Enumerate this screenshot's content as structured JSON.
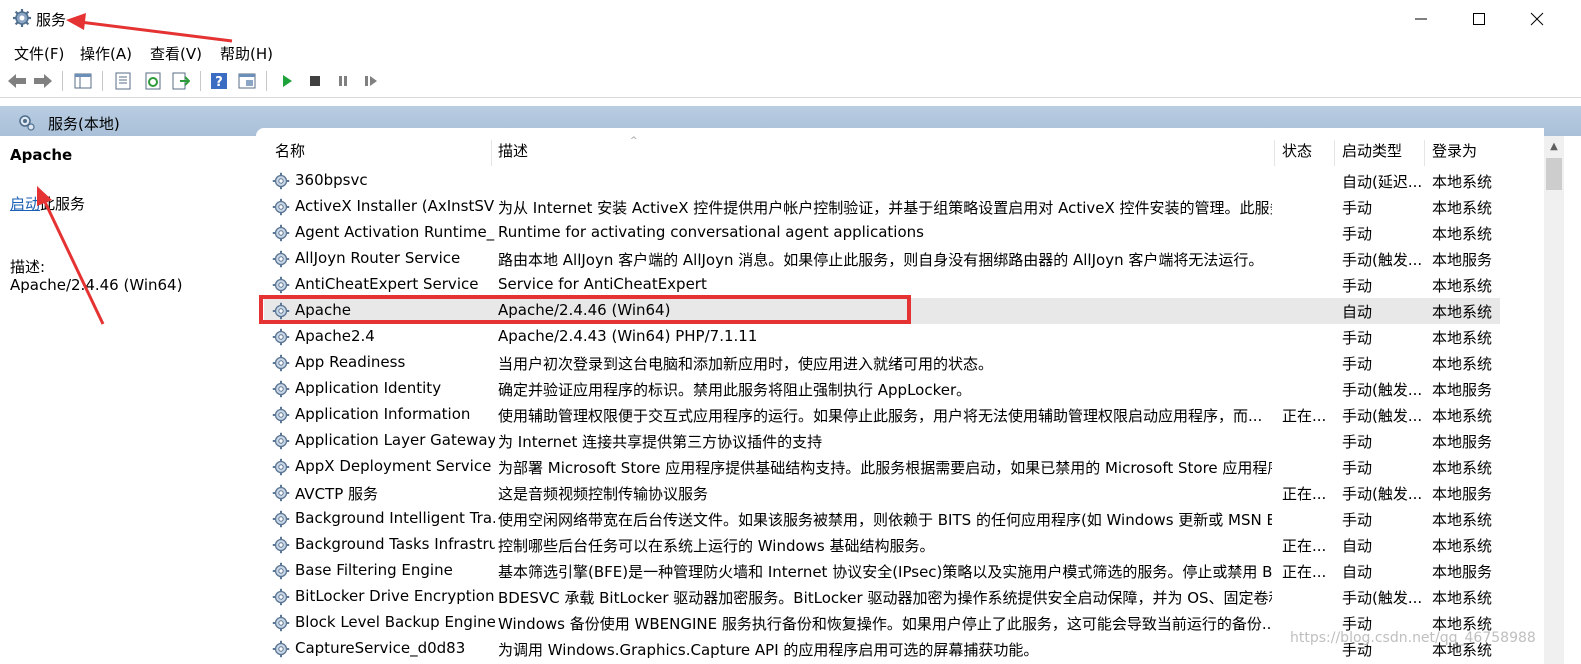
{
  "window": {
    "title": "服务",
    "icon": "gear-icon"
  },
  "menu": [
    "文件(F)",
    "操作(A)",
    "查看(V)",
    "帮助(H)"
  ],
  "toolbar": {
    "buttons": [
      "back-icon",
      "forward-icon",
      "show-tree-icon",
      "properties-icon",
      "refresh-icon",
      "export-icon",
      "help-icon",
      "console-icon",
      "start-service-icon",
      "stop-service-icon",
      "pause-service-icon",
      "restart-service-icon"
    ]
  },
  "scope": {
    "title": "服务(本地)"
  },
  "left_panel": {
    "service_name": "Apache",
    "start_link": "启动",
    "start_suffix": "此服务",
    "desc_label": "描述:",
    "desc_value": "Apache/2.4.46 (Win64)"
  },
  "columns": {
    "name": "名称",
    "desc": "描述",
    "status": "状态",
    "startup": "启动类型",
    "logon": "登录为"
  },
  "rows": [
    {
      "name": "360bpsvc",
      "desc": "",
      "status": "",
      "startup": "自动(延迟...",
      "logon": "本地系统"
    },
    {
      "name": "ActiveX Installer (AxInstSV)",
      "desc": "为从 Internet 安装 ActiveX 控件提供用户帐户控制验证，并基于组策略设置启用对 ActiveX 控件安装的管理。此服务...",
      "status": "",
      "startup": "手动",
      "logon": "本地系统"
    },
    {
      "name": "Agent Activation Runtime_...",
      "desc": "Runtime for activating conversational agent applications",
      "status": "",
      "startup": "手动",
      "logon": "本地系统"
    },
    {
      "name": "AllJoyn Router Service",
      "desc": "路由本地 AllJoyn 客户端的 AllJoyn 消息。如果停止此服务，则自身没有捆绑路由器的 AllJoyn 客户端将无法运行。",
      "status": "",
      "startup": "手动(触发...",
      "logon": "本地服务"
    },
    {
      "name": "AntiCheatExpert Service",
      "desc": "Service for AntiCheatExpert",
      "status": "",
      "startup": "手动",
      "logon": "本地系统"
    },
    {
      "name": "Apache",
      "desc": "Apache/2.4.46 (Win64)",
      "status": "",
      "startup": "自动",
      "logon": "本地系统"
    },
    {
      "name": "Apache2.4",
      "desc": "Apache/2.4.43 (Win64) PHP/7.1.11",
      "status": "",
      "startup": "手动",
      "logon": "本地系统"
    },
    {
      "name": "App Readiness",
      "desc": "当用户初次登录到这台电脑和添加新应用时，使应用进入就绪可用的状态。",
      "status": "",
      "startup": "手动",
      "logon": "本地系统"
    },
    {
      "name": "Application Identity",
      "desc": "确定并验证应用程序的标识。禁用此服务将阻止强制执行 AppLocker。",
      "status": "",
      "startup": "手动(触发...",
      "logon": "本地服务"
    },
    {
      "name": "Application Information",
      "desc": "使用辅助管理权限便于交互式应用程序的运行。如果停止此服务，用户将无法使用辅助管理权限启动应用程序，而...",
      "status": "正在...",
      "startup": "手动(触发...",
      "logon": "本地系统"
    },
    {
      "name": "Application Layer Gateway ...",
      "desc": "为 Internet 连接共享提供第三方协议插件的支持",
      "status": "",
      "startup": "手动",
      "logon": "本地服务"
    },
    {
      "name": "AppX Deployment Service ...",
      "desc": "为部署 Microsoft Store 应用程序提供基础结构支持。此服务根据需要启动，如果已禁用的 Microsoft Store 应用程序...",
      "status": "",
      "startup": "手动",
      "logon": "本地系统"
    },
    {
      "name": "AVCTP 服务",
      "desc": "这是音频视频控制传输协议服务",
      "status": "正在...",
      "startup": "手动(触发...",
      "logon": "本地服务"
    },
    {
      "name": "Background Intelligent Tra...",
      "desc": "使用空闲网络带宽在后台传送文件。如果该服务被禁用，则依赖于 BITS 的任何应用程序(如 Windows 更新或 MSN E...",
      "status": "",
      "startup": "手动",
      "logon": "本地系统"
    },
    {
      "name": "Background Tasks Infrastru...",
      "desc": "控制哪些后台任务可以在系统上运行的 Windows 基础结构服务。",
      "status": "正在...",
      "startup": "自动",
      "logon": "本地系统"
    },
    {
      "name": "Base Filtering Engine",
      "desc": "基本筛选引擎(BFE)是一种管理防火墙和 Internet 协议安全(IPsec)策略以及实施用户模式筛选的服务。停止或禁用 BF...",
      "status": "正在...",
      "startup": "自动",
      "logon": "本地服务"
    },
    {
      "name": "BitLocker Drive Encryption ...",
      "desc": "BDESVC 承载 BitLocker 驱动器加密服务。BitLocker 驱动器加密为操作系统提供安全启动保障，并为 OS、固定卷和...",
      "status": "",
      "startup": "手动(触发...",
      "logon": "本地系统"
    },
    {
      "name": "Block Level Backup Engine ...",
      "desc": "Windows 备份使用 WBENGINE 服务执行备份和恢复操作。如果用户停止了此服务，这可能会导致当前运行的备份...",
      "status": "",
      "startup": "手动",
      "logon": "本地系统"
    },
    {
      "name": "CaptureService_d0d83",
      "desc": "为调用 Windows.Graphics.Capture API 的应用程序启用可选的屏幕捕获功能。",
      "status": "",
      "startup": "手动",
      "logon": "本地系统"
    }
  ],
  "selected_row": "Apache",
  "watermark": "https://blog.csdn.net/qq_46758988",
  "colors": {
    "scope_header": "#b0c6dc",
    "highlight": "#e53333",
    "link": "#1a5fb4",
    "play_green": "#1fa23a"
  }
}
